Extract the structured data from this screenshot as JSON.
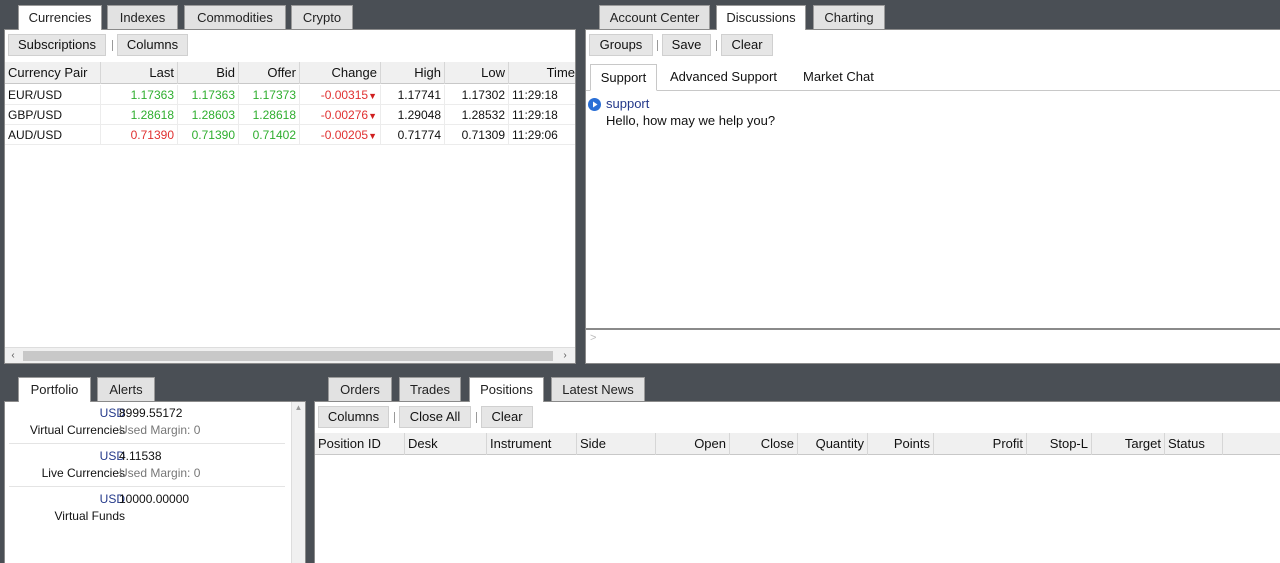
{
  "market_tabs": [
    "Currencies",
    "Indexes",
    "Commodities",
    "Crypto"
  ],
  "market_toolbar": {
    "subscriptions": "Subscriptions",
    "columns": "Columns"
  },
  "market_columns": [
    "Currency Pair",
    "Last",
    "Bid",
    "Offer",
    "Change",
    "High",
    "Low",
    "Time"
  ],
  "market_rows": [
    {
      "pair": "EUR/USD",
      "last": "1.17363",
      "bid": "1.17363",
      "offer": "1.17373",
      "change": "-0.00315",
      "high": "1.17741",
      "low": "1.17302",
      "time": "11:29:18"
    },
    {
      "pair": "GBP/USD",
      "last": "1.28618",
      "bid": "1.28603",
      "offer": "1.28618",
      "change": "-0.00276",
      "high": "1.29048",
      "low": "1.28532",
      "time": "11:29:18"
    },
    {
      "pair": "AUD/USD",
      "last": "0.71390",
      "bid": "0.71390",
      "offer": "0.71402",
      "change": "-0.00205",
      "high": "0.71774",
      "low": "0.71309",
      "time": "11:29:06"
    }
  ],
  "arrow_down": "▼",
  "scroll": {
    "left": "‹",
    "right": "›",
    "up": "▲"
  },
  "right_tabs": [
    "Account Center",
    "Discussions",
    "Charting"
  ],
  "discussions_toolbar": {
    "groups": "Groups",
    "save": "Save",
    "clear": "Clear"
  },
  "chat_tabs": [
    "Support",
    "Advanced Support",
    "Market Chat"
  ],
  "chat_messages": [
    {
      "sender": "support",
      "text": "Hello, how may we help you?"
    }
  ],
  "chat_prompt": ">",
  "portfolio_tabs": [
    "Portfolio",
    "Alerts"
  ],
  "portfolio": [
    {
      "currency": "USD",
      "amount": "8999.55172",
      "label": "Virtual Currencies",
      "margin": "Used Margin:  0"
    },
    {
      "currency": "USD",
      "amount": "4.11538",
      "label": "Live Currencies",
      "margin": "Used Margin:  0"
    },
    {
      "currency": "USD",
      "amount": "10000.00000",
      "label": "Virtual Funds",
      "margin": ""
    }
  ],
  "orders_tabs": [
    "Orders",
    "Trades",
    "Positions",
    "Latest News"
  ],
  "positions_toolbar": {
    "columns": "Columns",
    "close_all": "Close All",
    "clear": "Clear"
  },
  "positions_columns": [
    "Position ID",
    "Desk",
    "Instrument",
    "Side",
    "Open",
    "Close",
    "Quantity",
    "Points",
    "Profit",
    "Stop-L",
    "Target",
    "Status"
  ],
  "colors": {
    "background": "#4a4f55",
    "positive": "#2fae2f",
    "negative": "#e03030",
    "link": "#24398a"
  }
}
